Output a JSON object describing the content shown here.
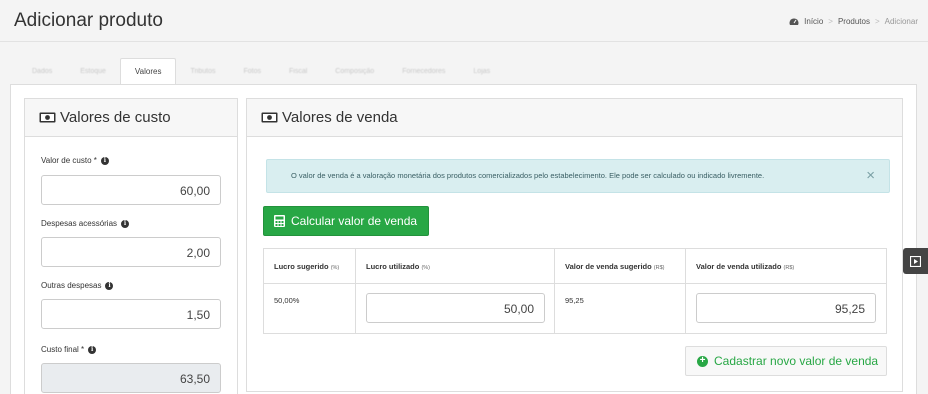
{
  "header": {
    "title": "Adicionar produto",
    "breadcrumb": [
      "Início",
      "Produtos",
      "Adicionar"
    ],
    "separator": ">"
  },
  "tabs": [
    {
      "label": "Dados",
      "active": false
    },
    {
      "label": "Estoque",
      "active": false
    },
    {
      "label": "Valores",
      "active": true
    },
    {
      "label": "Tributos",
      "active": false
    },
    {
      "label": "Fotos",
      "active": false
    },
    {
      "label": "Fiscal",
      "active": false
    },
    {
      "label": "Composição",
      "active": false
    },
    {
      "label": "Fornecedores",
      "active": false
    },
    {
      "label": "Lojas",
      "active": false
    }
  ],
  "cost": {
    "title": "Valores de custo",
    "fields": [
      {
        "label": "Valor de custo *",
        "value": "60,00"
      },
      {
        "label": "Despesas acessórias",
        "value": "2,00"
      },
      {
        "label": "Outras despesas",
        "value": "1,50"
      },
      {
        "label": "Custo final *",
        "value": "63,50"
      }
    ]
  },
  "sale": {
    "title": "Valores de venda",
    "alert": "O valor de venda é a valoração monetária dos produtos comercializados pelo estabelecimento. Ele pode ser calculado ou indicado livremente.",
    "alert_close": "×",
    "calc_button": "Calcular valor de venda",
    "columns": [
      {
        "label": "Lucro sugerido",
        "unit": "(%)"
      },
      {
        "label": "Lucro utilizado",
        "unit": "(%)"
      },
      {
        "label": "Valor de venda sugerido",
        "unit": "(R$)"
      },
      {
        "label": "Valor de venda utilizado",
        "unit": "(R$)"
      }
    ],
    "row": {
      "lucro_sugerido": "50,00%",
      "lucro_utilizado": "50,00",
      "venda_sugerido": "95,25",
      "venda_utilizado": "95,25"
    },
    "new_button": "Cadastrar novo valor de venda"
  },
  "colors": {
    "green": "#28a745",
    "alert_bg": "#d9eef0"
  }
}
